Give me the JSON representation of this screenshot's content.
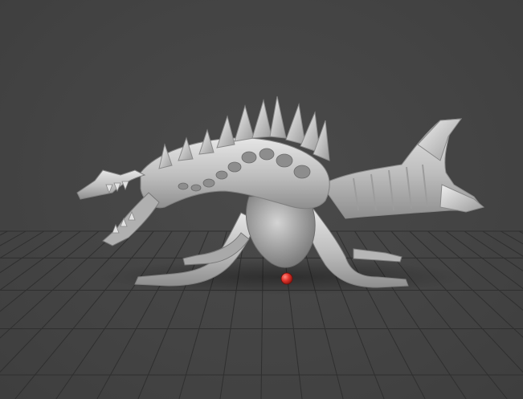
{
  "viewport": {
    "background_color": "#444444",
    "grid_color": "#2f2f2f",
    "model_color": "#c9c9c9",
    "pivot_marker_color": "#e0342c",
    "model_name_icon": "dragon-sculpt-icon"
  }
}
